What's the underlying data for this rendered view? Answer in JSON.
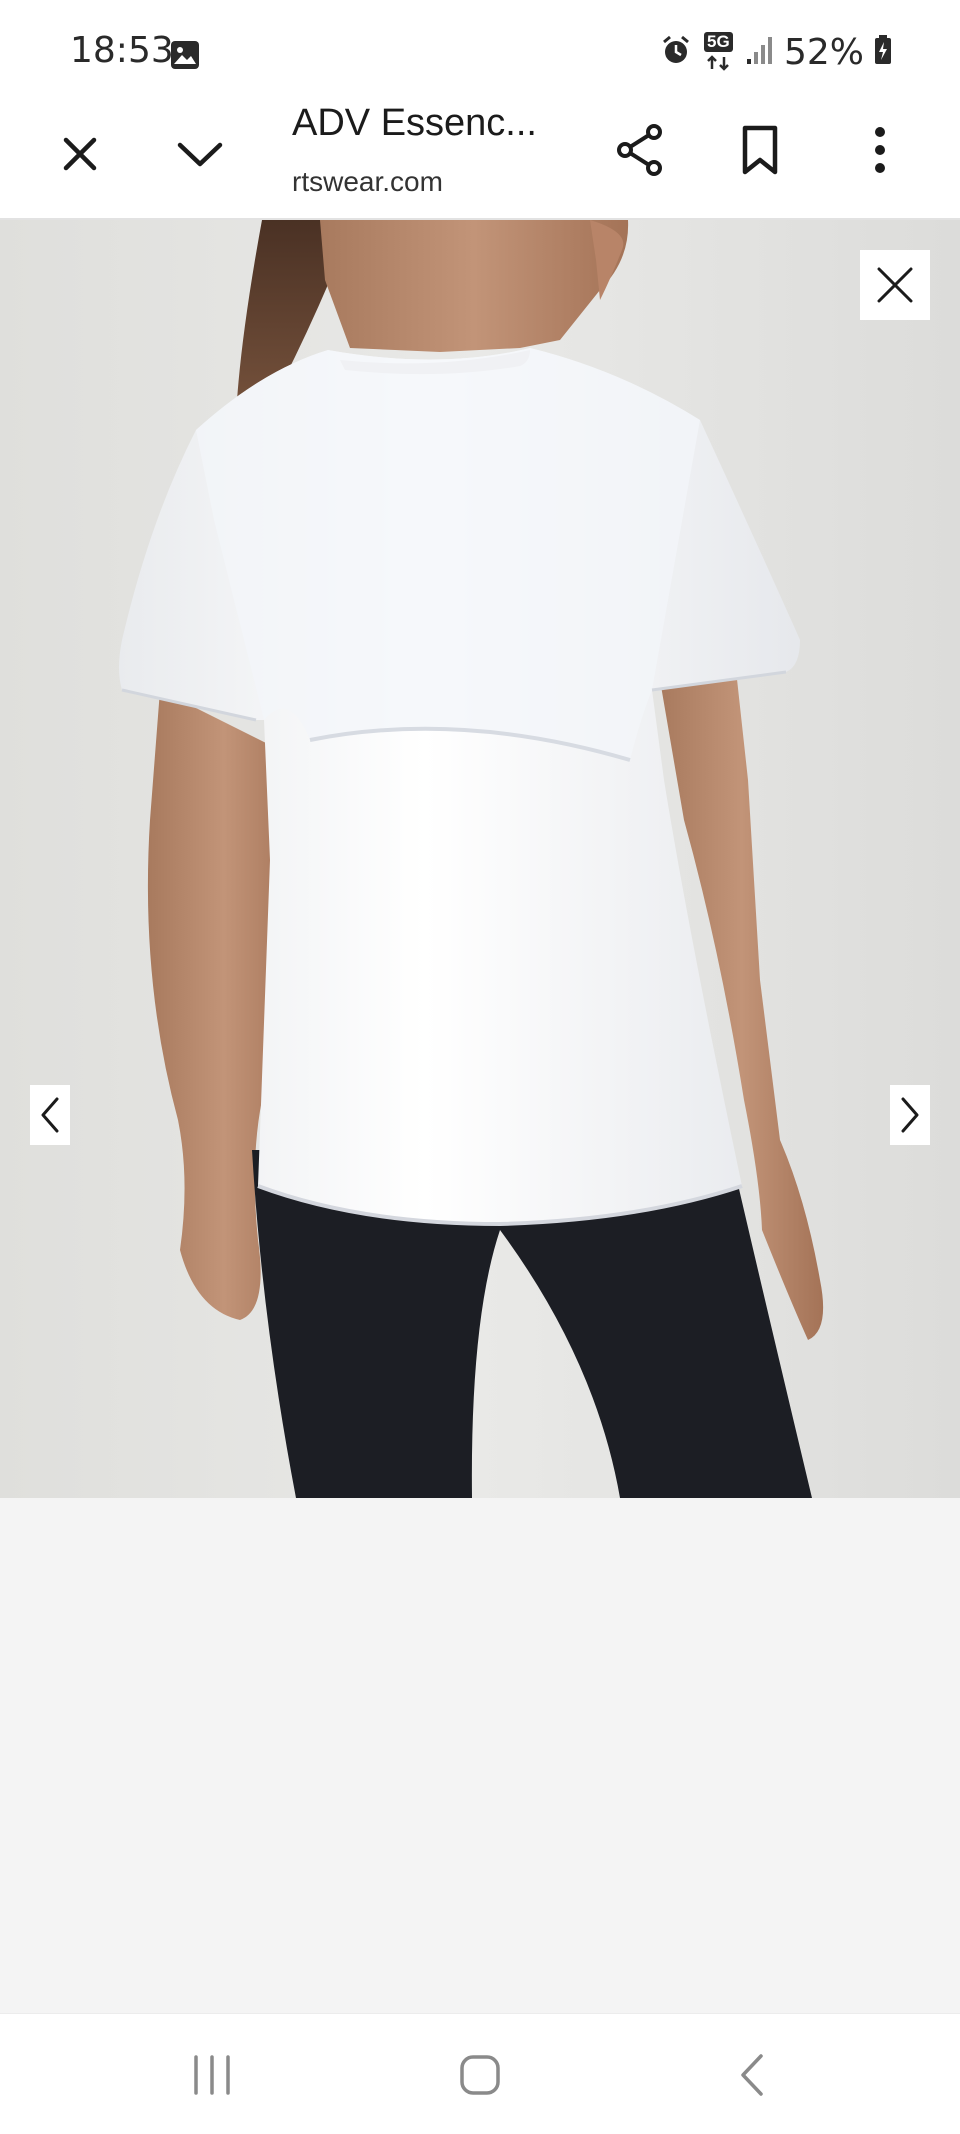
{
  "status_bar": {
    "time": "18:53",
    "network_label": "5G",
    "battery_percent": "52%",
    "icons": [
      "gallery-icon",
      "alarm-icon",
      "network-5g-icon",
      "signal-icon",
      "battery-charging-icon"
    ]
  },
  "tab": {
    "title": "ADV Essenc...",
    "url": "rtswear.com",
    "icons": [
      "close-icon",
      "chevron-down-icon",
      "share-icon",
      "bookmark-icon",
      "more-vert-icon"
    ]
  },
  "image_viewer": {
    "subject": "white short-sleeve t-shirt, back view",
    "icons": [
      "close-icon",
      "chevron-left-icon",
      "chevron-right-icon"
    ]
  },
  "system_nav": {
    "icons": [
      "recent-apps-icon",
      "home-icon",
      "back-icon"
    ]
  },
  "colors": {
    "status_bar_bg": "#ffffff",
    "viewer_bg": "#e6e6e4",
    "page_bg": "#f4f4f4",
    "icon_color": "#1b1b1b"
  }
}
